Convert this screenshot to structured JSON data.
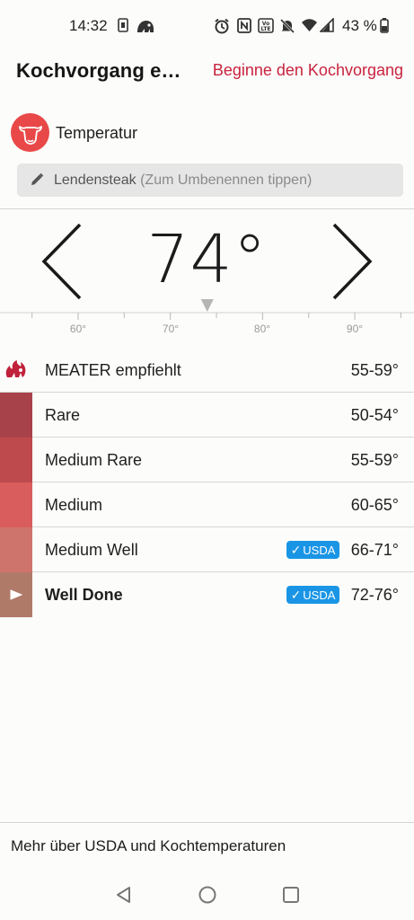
{
  "status_bar": {
    "time": "14:32",
    "battery": "43 %",
    "icons": [
      "sim-card-icon",
      "creature-icon",
      "alarm-icon",
      "nfc-icon",
      "volte-icon",
      "mute-icon",
      "wifi-icon",
      "signal-icon",
      "battery-icon"
    ]
  },
  "header": {
    "title": "Kochvorgang e…",
    "action": "Beginne den Kochvorgang"
  },
  "meat": {
    "icon": "cow-icon",
    "label": "Temperatur"
  },
  "name_field": {
    "value": "Lendensteak",
    "hint": "(Zum Umbenennen tippen)"
  },
  "temperature": {
    "value": "74°",
    "current": 74,
    "scale_min": 55,
    "scale_max": 98,
    "tick_labels": [
      "60°",
      "70°",
      "80°",
      "90°"
    ]
  },
  "recommendation": {
    "label": "MEATER empfiehlt",
    "range": "55-59°",
    "icon": "flame-icon"
  },
  "doneness": [
    {
      "name": "Rare",
      "range": "50-54°",
      "color": "#a8424a",
      "usda": false,
      "selected": false
    },
    {
      "name": "Medium Rare",
      "range": "55-59°",
      "color": "#be4a4d",
      "usda": false,
      "selected": false
    },
    {
      "name": "Medium",
      "range": "60-65°",
      "color": "#d95d5c",
      "usda": false,
      "selected": false
    },
    {
      "name": "Medium Well",
      "range": "66-71°",
      "color": "#cf746c",
      "usda": true,
      "selected": false
    },
    {
      "name": "Well Done",
      "range": "72-76°",
      "color": "#b07a69",
      "usda": true,
      "selected": true
    }
  ],
  "usda_badge": "USDA",
  "footer": {
    "link": "Mehr über USDA und Kochtemperaturen"
  },
  "colors": {
    "accent": "#c9233f",
    "usda_blue": "#1a95e6",
    "meat_red": "#e94848"
  }
}
